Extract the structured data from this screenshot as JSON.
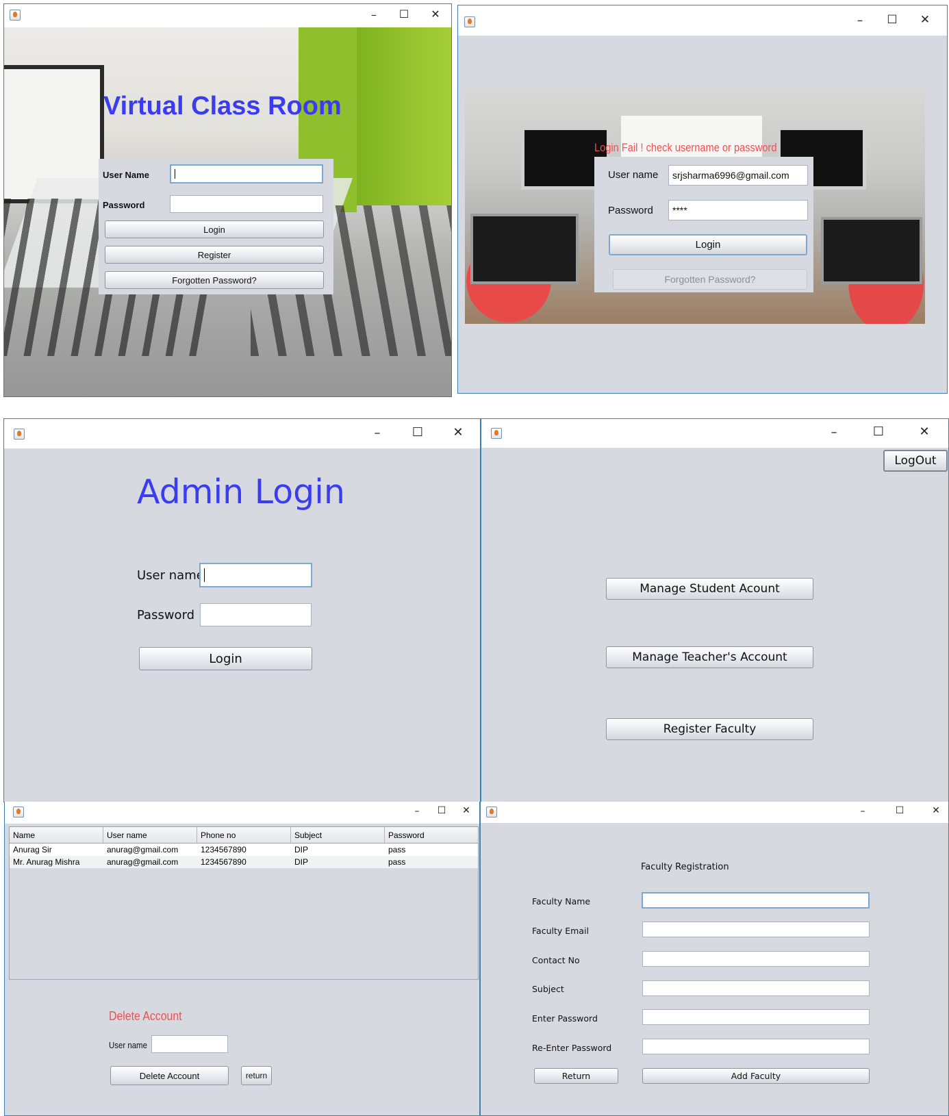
{
  "login_window": {
    "title_text": "Virtual Class Room",
    "username_label": "User Name",
    "username_value": "",
    "password_label": "Password",
    "password_value": "",
    "login_button": "Login",
    "register_button": "Register",
    "forgot_button": "Forgotten Password?"
  },
  "login_fail_window": {
    "error_message": "Login Fail ! check username or password",
    "username_label": "User name",
    "username_value": "srjsharma6996@gmail.com",
    "password_label": "Password",
    "password_value": "****",
    "login_button": "Login",
    "forgot_button": "Forgotten Password?"
  },
  "admin_login_window": {
    "title_text": "Admin Login",
    "username_label": "User name",
    "username_value": "",
    "password_label": "Password",
    "password_value": "",
    "login_button": "Login"
  },
  "admin_menu_window": {
    "logout_button": "LogOut",
    "manage_student_button": "Manage Student Acount",
    "manage_teacher_button": "Manage Teacher's Account",
    "register_faculty_button": "Register Faculty"
  },
  "teacher_table_window": {
    "columns": [
      "Name",
      "User name",
      "Phone no",
      "Subject",
      "Password"
    ],
    "rows": [
      [
        "Anurag Sir",
        "anurag@gmail.com",
        "1234567890",
        "DIP",
        "pass"
      ],
      [
        "Mr. Anurag Mishra",
        "anurag@gmail.com",
        "1234567890",
        "DIP",
        "pass"
      ]
    ],
    "delete_heading": "Delete Account",
    "username_label": "User name",
    "username_value": "",
    "delete_button": "Delete Account",
    "return_button": "return"
  },
  "faculty_registration_window": {
    "heading": "Faculty Registration",
    "fields": [
      {
        "label": "Faculty Name",
        "value": ""
      },
      {
        "label": "Faculty Email",
        "value": ""
      },
      {
        "label": "Contact No",
        "value": ""
      },
      {
        "label": "Subject",
        "value": ""
      },
      {
        "label": "Enter Password",
        "value": ""
      },
      {
        "label": "Re-Enter Password",
        "value": ""
      }
    ],
    "return_button": "Return",
    "add_button": "Add Faculty"
  },
  "window_controls": {
    "minimize": "–",
    "maximize": "☐",
    "close": "✕"
  },
  "colors": {
    "accent_blue": "#3b3bf0",
    "error_red": "#f05050",
    "window_bg": "#d6d9df",
    "border_blue": "#3c7fb1"
  }
}
